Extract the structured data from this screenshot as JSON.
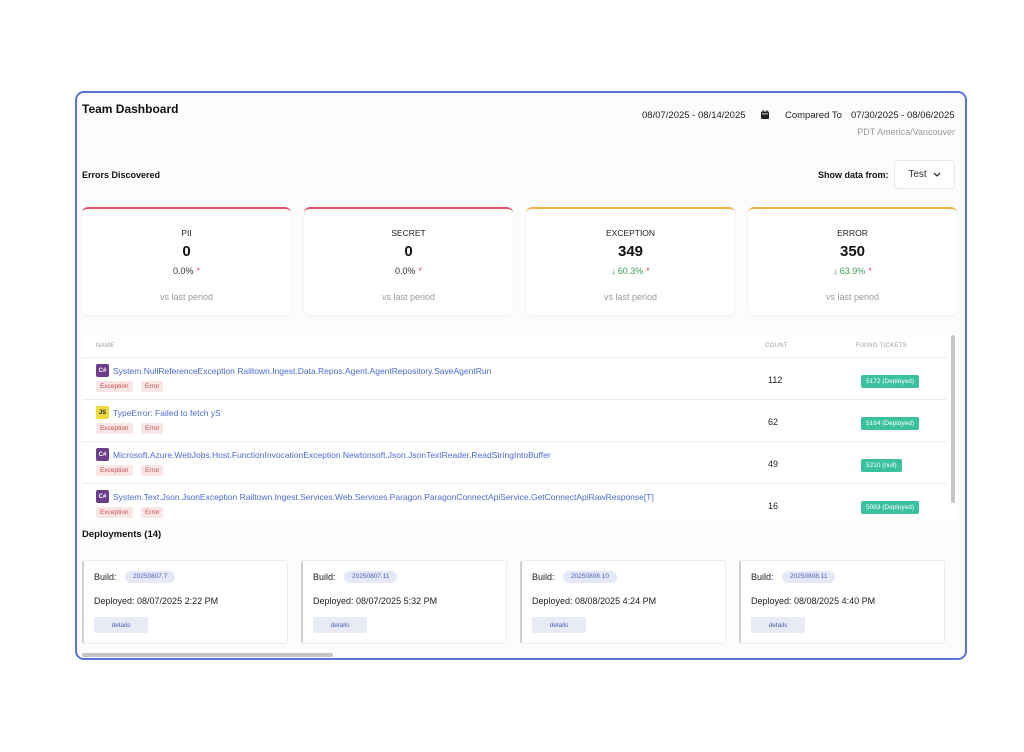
{
  "header": {
    "title": "Team Dashboard",
    "date_range": "08/07/2025 - 08/14/2025",
    "compared_label": "Compared To",
    "compared_range": "07/30/2025 - 08/06/2025",
    "timezone": "PDT America/Vancouver"
  },
  "errors_section": {
    "title": "Errors Discovered",
    "show_data_label": "Show data from:",
    "environment": "Test"
  },
  "cards": [
    {
      "label": "PII",
      "value": "0",
      "change": "0.0%",
      "star": "*",
      "sub": "vs last period",
      "accent": "#e0506a"
    },
    {
      "label": "SECRET",
      "value": "0",
      "change": "0.0%",
      "star": "*",
      "sub": "vs last period",
      "accent": "#e0506a"
    },
    {
      "label": "EXCEPTION",
      "value": "349",
      "change": "60.3%",
      "star": "*",
      "sub": "vs last period",
      "accent": "#f2b24a",
      "trend_icon": "arrow-down-icon"
    },
    {
      "label": "ERROR",
      "value": "350",
      "change": "63.9%",
      "star": "*",
      "sub": "vs last period",
      "accent": "#f2b24a",
      "trend_icon": "arrow-down-icon"
    }
  ],
  "table": {
    "columns": [
      "NAME",
      "COUNT",
      "FIXING TICKETS"
    ],
    "rows": [
      {
        "lang": "C#",
        "name": "System.NullReferenceException Railtown.Ingest.Data.Repos.Agent.AgentRepository.SaveAgentRun",
        "tags": [
          "Exception",
          "Error"
        ],
        "count": "112",
        "ticket": "5172 (Deployed)"
      },
      {
        "lang": "JS",
        "name": "TypeError: Failed to fetch yS",
        "tags": [
          "Exception",
          "Error"
        ],
        "count": "62",
        "ticket": "5164 (Deployed)"
      },
      {
        "lang": "C#",
        "name": "Microsoft.Azure.WebJobs.Host.FunctionInvocationException Newtonsoft.Json.JsonTextReader.ReadStringIntoBuffer",
        "tags": [
          "Exception",
          "Error"
        ],
        "count": "49",
        "ticket": "5210 (null)"
      },
      {
        "lang": "C#",
        "name": "System.Text.Json.JsonException Railtown.Ingest.Services.Web.Services.Paragon.ParagonConnectApiService.GetConnectApiRawResponse[T]",
        "tags": [
          "Exception",
          "Error"
        ],
        "count": "16",
        "ticket": "5083 (Deployed)"
      }
    ]
  },
  "deployments": {
    "title": "Deployments (14)",
    "items": [
      {
        "build_label": "Build:",
        "build": "20250807.7",
        "deployed": "Deployed: 08/07/2025 2:22 PM",
        "button": "details"
      },
      {
        "build_label": "Build:",
        "build": "20250807.11",
        "deployed": "Deployed: 08/07/2025 5:32 PM",
        "button": "details"
      },
      {
        "build_label": "Build:",
        "build": "20250808.10",
        "deployed": "Deployed: 08/08/2025 4:24 PM",
        "button": "details"
      },
      {
        "build_label": "Build:",
        "build": "20250808.11",
        "deployed": "Deployed: 08/08/2025 4:40 PM",
        "button": "details"
      }
    ]
  },
  "colors": {
    "frame_border": "#5b72d6",
    "link": "#4b6bd6",
    "ticket": "#3cc19f",
    "positive_trend": "#3a9b55"
  }
}
